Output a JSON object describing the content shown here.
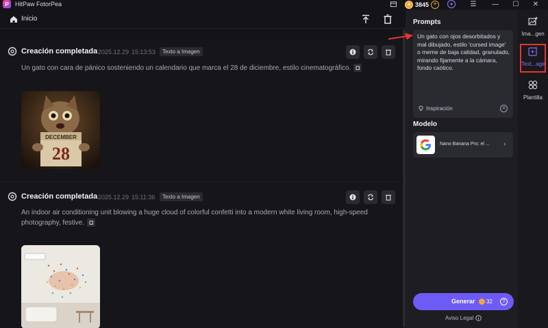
{
  "window": {
    "title": "HitPaw FotorPea",
    "coins": "3845",
    "controls": [
      "gift-icon",
      "user-icon",
      "menu-icon",
      "minimize-icon",
      "maximize-icon",
      "close-icon"
    ]
  },
  "header": {
    "home_label": "Inicio"
  },
  "feed": [
    {
      "status": "Creación completada",
      "date": "2025.12.29",
      "time": "15:13:53",
      "tag": "Texto a Imagen",
      "prompt": "Un gato con cara de pánico sosteniendo un calendario que marca el 28 de diciembre, estilo cinematográfico.",
      "image_text_month": "DECEMBER",
      "image_text_day": "28"
    },
    {
      "status": "Creación completada",
      "date": "2025.12.29",
      "time": "15:11:36",
      "tag": "Texto a Imagen",
      "prompt": "An indoor air conditioning unit blowing a huge cloud of colorful confetti into a modern white living room, high-speed photography, festive."
    }
  ],
  "panel": {
    "prompts_heading": "Prompts",
    "prompt_text": "Un gato con ojos desorbitados y mal dibujado, estilo 'cursed image' o meme de baja calidad, granulado, mirando fijamente a la cámara, fondo caótico.",
    "inspiration_label": "Inspiración",
    "model_heading": "Modelo",
    "model_name": "Nano Banana Pro: el ...",
    "generate_label": "Generar",
    "generate_cost": "32",
    "legal_label": "Aviso Legal"
  },
  "rail": [
    {
      "label": "Ima...gen",
      "icon": "image-plus-icon"
    },
    {
      "label": "Text...age",
      "icon": "text-to-image-icon",
      "active": true
    },
    {
      "label": "Plantilla",
      "icon": "template-icon"
    }
  ],
  "colors": {
    "accent": "#6e5bf5",
    "coin": "#f3a63b",
    "annotation": "#e5372f"
  }
}
